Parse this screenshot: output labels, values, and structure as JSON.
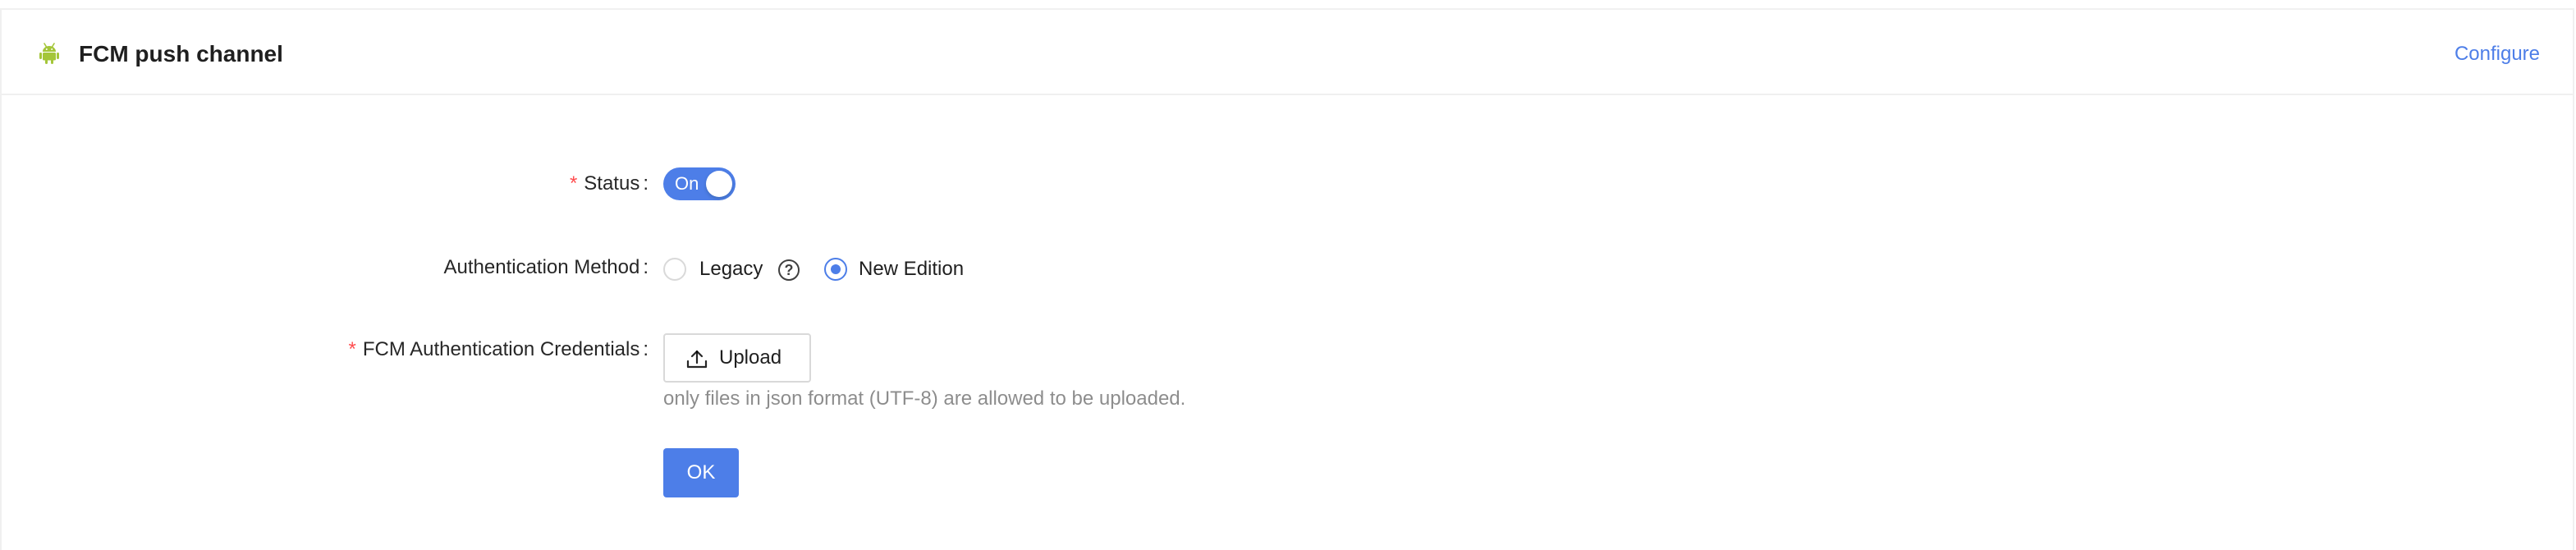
{
  "card": {
    "title": "FCM push channel",
    "configure_label": "Configure",
    "icon": "android-icon"
  },
  "form": {
    "status": {
      "required": true,
      "label": "Status",
      "colon": ":",
      "toggle_text": "On",
      "toggle_on": true
    },
    "auth_method": {
      "required": false,
      "label": "Authentication Method",
      "colon": ":",
      "options": [
        {
          "label": "Legacy",
          "checked": false,
          "help_icon": "question-circle-icon",
          "help_glyph": "?"
        },
        {
          "label": "New Edition",
          "checked": true
        }
      ]
    },
    "credentials": {
      "required": true,
      "label": "FCM Authentication Credentials",
      "colon": ":",
      "upload_label": "Upload",
      "upload_icon": "upload-icon",
      "hint": "only files in json format (UTF-8) are allowed to be uploaded."
    },
    "ok_label": "OK"
  },
  "colors": {
    "primary": "#4d7ee8",
    "required": "#ff4d4f",
    "android": "#a4c639",
    "border": "#d9d9d9"
  }
}
